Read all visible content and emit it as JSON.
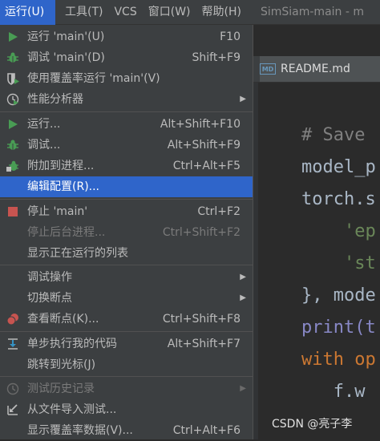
{
  "menubar": {
    "items": [
      "运行(U)",
      "工具(T)",
      "VCS",
      "窗口(W)",
      "帮助(H)"
    ],
    "window_title": "SimSiam-main - m"
  },
  "editor": {
    "tab_label": "README.md",
    "tab_icon": "MD",
    "code_lines": [
      {
        "text": "# Save",
        "kind": "comment"
      },
      {
        "text": "model_p",
        "kind": "ident"
      },
      {
        "text": "torch.s",
        "kind": "ident"
      },
      {
        "text": "    'ep",
        "kind": "str"
      },
      {
        "text": "    'st",
        "kind": "str"
      },
      {
        "text": "}, mode",
        "kind": "ident"
      },
      {
        "text": "print(t",
        "kind": "fn"
      },
      {
        "text": "with op",
        "kind": "kw"
      },
      {
        "text": "   f.w",
        "kind": "ident"
      }
    ]
  },
  "watermark": "CSDN @亮子李",
  "menu": {
    "items": [
      {
        "label": "运行 'main'(U)",
        "shortcut": "F10",
        "icon": "run-triangle-icon",
        "color": "#499c54"
      },
      {
        "label": "调试 'main'(D)",
        "shortcut": "Shift+F9",
        "icon": "debug-bug-icon",
        "color": "#499c54"
      },
      {
        "label": "使用覆盖率运行  'main'(V)",
        "shortcut": "",
        "icon": "coverage-shield-icon",
        "color": "#bbbbbb"
      },
      {
        "label": "性能分析器",
        "shortcut": "",
        "icon": "profiler-clock-icon",
        "submenu": true
      },
      {
        "label": "运行...",
        "shortcut": "Alt+Shift+F10",
        "icon": "run-triangle-icon",
        "color": "#499c54"
      },
      {
        "label": "调试...",
        "shortcut": "Alt+Shift+F9",
        "icon": "debug-bug-icon",
        "color": "#499c54"
      },
      {
        "label": "附加到进程...",
        "shortcut": "Ctrl+Alt+F5",
        "icon": "attach-process-icon",
        "color": "#499c54"
      },
      {
        "label": "编辑配置(R)...",
        "shortcut": "",
        "icon": "",
        "selected": true
      },
      {
        "label": "停止 'main'",
        "shortcut": "Ctrl+F2",
        "icon": "stop-square-icon",
        "color": "#c75450"
      },
      {
        "label": "停止后台进程...",
        "shortcut": "Ctrl+Shift+F2",
        "icon": "",
        "disabled": true
      },
      {
        "label": "显示正在运行的列表",
        "shortcut": "",
        "icon": ""
      },
      {
        "label": "调试操作",
        "shortcut": "",
        "icon": "",
        "submenu": true
      },
      {
        "label": "切换断点",
        "shortcut": "",
        "icon": "",
        "submenu": true
      },
      {
        "label": "查看断点(K)...",
        "shortcut": "Ctrl+Shift+F8",
        "icon": "breakpoints-icon",
        "color": "#c75450"
      },
      {
        "label": "单步执行我的代码",
        "shortcut": "Alt+Shift+F7",
        "icon": "step-into-icon",
        "color": "#3592c4"
      },
      {
        "label": "跳转到光标(J)",
        "shortcut": "",
        "icon": ""
      },
      {
        "label": "测试历史记录",
        "shortcut": "",
        "icon": "history-clock-icon",
        "submenu": true,
        "disabled": true
      },
      {
        "label": "从文件导入测试...",
        "shortcut": "",
        "icon": "import-arrow-icon"
      },
      {
        "label": "显示覆盖率数据(V)...",
        "shortcut": "Ctrl+Alt+F6",
        "icon": ""
      }
    ]
  },
  "colors": {
    "accent": "#2f65ca",
    "run_green": "#499c54",
    "stop_red": "#c75450",
    "step_blue": "#3592c4"
  }
}
